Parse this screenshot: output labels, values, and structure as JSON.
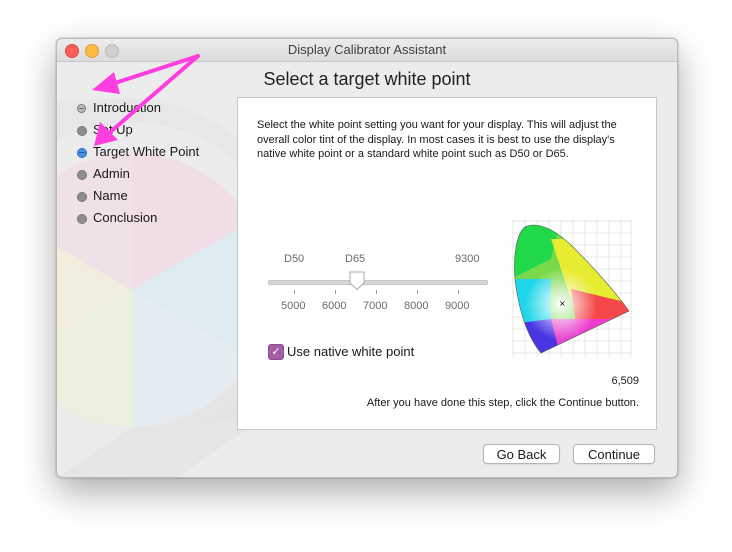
{
  "window": {
    "title": "Display Calibrator Assistant"
  },
  "page": {
    "title": "Select a target white point"
  },
  "steps": [
    {
      "label": "Introduction",
      "state": "done"
    },
    {
      "label": "Set Up",
      "state": "pending"
    },
    {
      "label": "Target White Point",
      "state": "active"
    },
    {
      "label": "Admin",
      "state": "pending"
    },
    {
      "label": "Name",
      "state": "pending"
    },
    {
      "label": "Conclusion",
      "state": "pending"
    }
  ],
  "content": {
    "description": "Select the white point setting you want for your display.  This will adjust the overall color tint of the display.  In most cases it is best to use the display's native white point or a standard white point such as D50 or D65.",
    "slider": {
      "top_labels": [
        "D50",
        "D65",
        "9300"
      ],
      "scale_labels": [
        "5000",
        "6000",
        "7000",
        "8000",
        "9000"
      ],
      "value": 6509
    },
    "native_checkbox": {
      "label": "Use native white point",
      "checked": true
    },
    "kelvin_value": "6,509",
    "after_step_text": "After you have done this step, click the Continue button."
  },
  "buttons": {
    "back": "Go Back",
    "continue": "Continue"
  },
  "colors": {
    "accent_checkbox": "#a35fa6",
    "active_step": "#4a90e2",
    "annotation_arrow": "#ff3ee0"
  }
}
